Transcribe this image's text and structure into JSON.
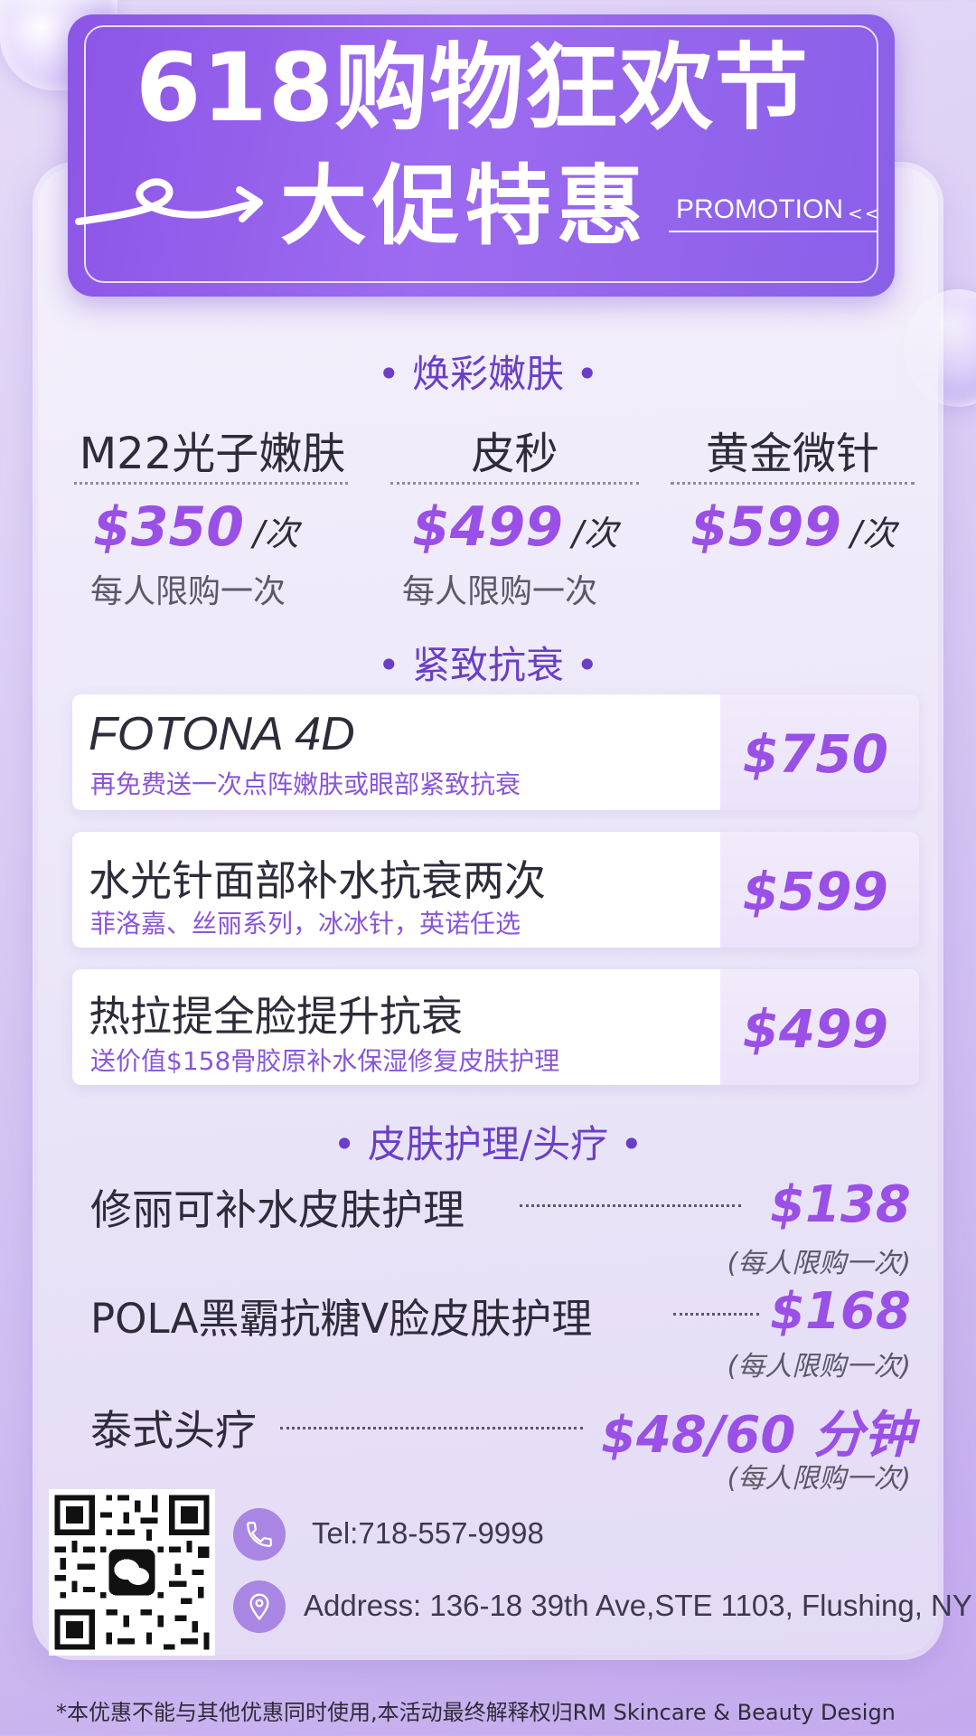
{
  "header": {
    "title_line1": "618购物狂欢节",
    "title_line2": "大促特惠",
    "promo_label": "PROMOTION",
    "promo_arrows": "<<"
  },
  "section1": {
    "title": "• 焕彩嫩肤 •",
    "items": [
      {
        "name": "M22光子嫩肤",
        "price": "$350",
        "unit": "/次",
        "limit": "每人限购一次"
      },
      {
        "name": "皮秒",
        "price": "$499",
        "unit": "/次",
        "limit": "每人限购一次"
      },
      {
        "name": "黄金微针",
        "price": "$599",
        "unit": "/次",
        "limit": ""
      }
    ]
  },
  "section2": {
    "title": "• 紧致抗衰 •",
    "items": [
      {
        "name": "FOTONA 4D",
        "desc": "再免费送一次点阵嫩肤或眼部紧致抗衰",
        "price": "$750"
      },
      {
        "name": "水光针面部补水抗衰两次",
        "desc": "菲洛嘉、丝丽系列，冰冰针，英诺任选",
        "price": "$599"
      },
      {
        "name": "热拉提全脸提升抗衰",
        "desc": "送价值$158骨胶原补水保湿修复皮肤护理",
        "price": "$499"
      }
    ]
  },
  "section3": {
    "title": "• 皮肤护理/头疗 •",
    "items": [
      {
        "name": "修丽可补水皮肤护理",
        "price": "$138",
        "limit": "(每人限购一次)"
      },
      {
        "name": "POLA黑霸抗糖V脸皮肤护理",
        "price": "$168",
        "limit": "(每人限购一次)"
      },
      {
        "name": "泰式头疗",
        "price": "$48/60 分钟",
        "limit": "(每人限购一次)"
      }
    ]
  },
  "contact": {
    "tel": "Tel:718-557-9998",
    "address": "Address:  136-18 39th Ave,STE 1103, Flushing, NY",
    "phone_icon": "phone-icon",
    "location_icon": "location-pin-icon",
    "qr_icon": "wechat-qr-code"
  },
  "footer": {
    "disclaimer": "*本优惠不能与其他优惠同时使用,本活动最终解释权归RM Skincare & Beauty Design"
  },
  "colors": {
    "accent_purple": "#9a4fe6",
    "banner_purple": "#8b55e6",
    "text_dark": "#2e2b3a"
  }
}
